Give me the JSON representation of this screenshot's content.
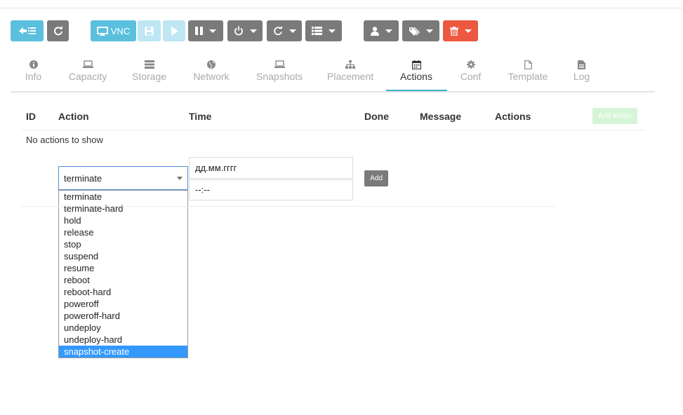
{
  "toolbar": {
    "vnc_label": "VNC",
    "buttons": [
      {
        "name": "back-to-list",
        "icon": "arrow-left-list-icon",
        "color": "#5bc0de"
      },
      {
        "name": "refresh",
        "icon": "refresh-icon",
        "color": "#7a7a7a"
      },
      {
        "name": "vnc",
        "icon": "monitor-icon",
        "color": "#5bc0de"
      },
      {
        "name": "save",
        "icon": "floppy-disk-icon",
        "color": "#bfe6f3"
      },
      {
        "name": "play",
        "icon": "play-icon",
        "color": "#bfe6f3"
      },
      {
        "name": "pause-menu",
        "icon": "pause-icon",
        "color": "#7a7a7a"
      },
      {
        "name": "power-menu",
        "icon": "power-icon",
        "color": "#7a7a7a"
      },
      {
        "name": "reboot-menu",
        "icon": "redo-icon",
        "color": "#7a7a7a"
      },
      {
        "name": "list-menu",
        "icon": "list-icon",
        "color": "#7a7a7a"
      },
      {
        "name": "user-menu",
        "icon": "user-icon",
        "color": "#7a7a7a"
      },
      {
        "name": "tag-menu",
        "icon": "tags-icon",
        "color": "#7a7a7a"
      },
      {
        "name": "delete-menu",
        "icon": "trash-icon",
        "color": "#ec5840"
      }
    ]
  },
  "tabs": [
    {
      "label": "Info",
      "icon": "info-icon",
      "active": false
    },
    {
      "label": "Capacity",
      "icon": "laptop-icon",
      "active": false
    },
    {
      "label": "Storage",
      "icon": "storage-icon",
      "active": false
    },
    {
      "label": "Network",
      "icon": "globe-icon",
      "active": false
    },
    {
      "label": "Snapshots",
      "icon": "laptop-icon",
      "active": false
    },
    {
      "label": "Placement",
      "icon": "sitemap-icon",
      "active": false
    },
    {
      "label": "Actions",
      "icon": "calendar-icon",
      "active": true
    },
    {
      "label": "Conf",
      "icon": "gear-icon",
      "active": false
    },
    {
      "label": "Template",
      "icon": "file-icon",
      "active": false
    },
    {
      "label": "Log",
      "icon": "file-text-icon",
      "active": false
    }
  ],
  "table": {
    "headers": [
      "ID",
      "Action",
      "Time",
      "Done",
      "Message",
      "Actions"
    ],
    "add_action_label": "Add action",
    "empty_text": "No actions to show"
  },
  "form": {
    "selected_action": "terminate",
    "options": [
      "terminate",
      "terminate-hard",
      "hold",
      "release",
      "stop",
      "suspend",
      "resume",
      "reboot",
      "reboot-hard",
      "poweroff",
      "poweroff-hard",
      "undeploy",
      "undeploy-hard",
      "snapshot-create"
    ],
    "highlighted_option": "snapshot-create",
    "date_placeholder": "дд.мм.гггг",
    "time_placeholder": "--:--",
    "add_label": "Add"
  },
  "colors": {
    "accent": "#5bc0de",
    "danger": "#ec5840",
    "neutral": "#7a7a7a",
    "tab_underline": "#3ab0c8",
    "option_highlight": "#3399ff"
  }
}
